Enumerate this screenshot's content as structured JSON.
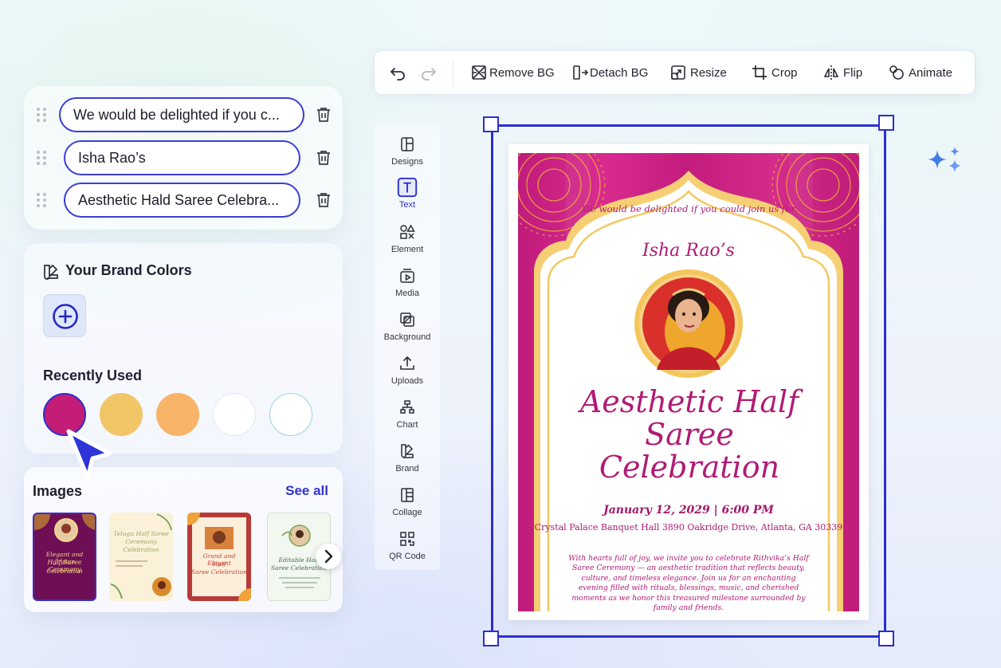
{
  "layers": [
    {
      "text": "We would be delighted if you c..."
    },
    {
      "text": "Isha Rao’s"
    },
    {
      "text": "Aesthetic Hald Saree Celebra..."
    }
  ],
  "brand_colors": {
    "title": "Your Brand Colors",
    "recently_used_title": "Recently Used",
    "recent_swatches": [
      "#c41d78",
      "#f2c566",
      "#f8b468",
      "#ffffff",
      "#ffffff"
    ]
  },
  "images_panel": {
    "title": "Images",
    "see_all": "See all",
    "thumbs": [
      {
        "line1": "Elegant and Joyous",
        "line2": "Half Saree Ceremony",
        "line3": "Celebration",
        "bg": "#6e0f55"
      },
      {
        "line1": "Telugu Half Saree",
        "line2": "Ceremony",
        "line3": "Celebration",
        "bg": "#fbf1d8"
      },
      {
        "line1": "Grand and Elegant",
        "line2": "Half",
        "line3": "Saree Celebration",
        "bg": "#b83a38"
      },
      {
        "line1": "Editable Half",
        "line2": "Saree Celebration",
        "line3": "",
        "bg": "#f2f7f0"
      }
    ]
  },
  "toolbar": {
    "remove_bg": "Remove BG",
    "detach_bg": "Detach BG",
    "resize": "Resize",
    "crop": "Crop",
    "flip": "Flip",
    "animate": "Animate"
  },
  "sidenav": [
    "Designs",
    "Text",
    "Element",
    "Media",
    "Background",
    "Uploads",
    "Chart",
    "Brand",
    "Collage",
    "QR Code"
  ],
  "poster": {
    "subtitle": "We would be delighted if you could join us for",
    "name": "Isha Rao’s",
    "title": "Aesthetic Half Saree Celebration",
    "date": "January 12, 2029 | 6:00 PM",
    "venue": "Crystal Palace Banquet Hall 3890 Oakridge Drive, Atlanta, GA 30339",
    "body": "With hearts full of joy, we invite you to celebrate Rithvika’s Half Saree Ceremony — an aesthetic tradition that reflects beauty, culture, and timeless elegance. Join us for an enchanting evening filled with rituals, blessings, music, and cherished moments as we honor this treasured milestone surrounded by family and friends."
  },
  "colors": {
    "accent": "#2a2fd0",
    "magenta": "#c41d78",
    "gold": "#f2c566"
  }
}
